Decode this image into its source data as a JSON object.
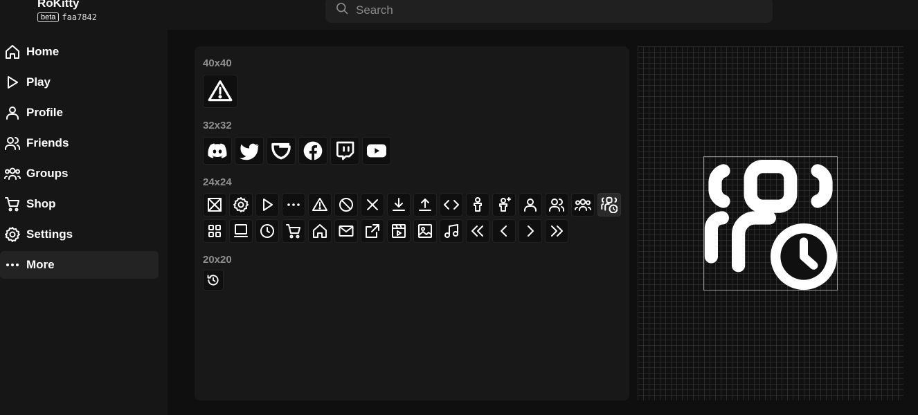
{
  "app": {
    "name": "RoKitty",
    "badge": "beta",
    "commit": "faa7842"
  },
  "search": {
    "placeholder": "Search",
    "value": ""
  },
  "sidebar": {
    "items": [
      {
        "label": "Home",
        "icon": "home-icon"
      },
      {
        "label": "Play",
        "icon": "play-icon"
      },
      {
        "label": "Profile",
        "icon": "profile-icon"
      },
      {
        "label": "Friends",
        "icon": "friends-icon"
      },
      {
        "label": "Groups",
        "icon": "groups-icon"
      },
      {
        "label": "Shop",
        "icon": "cart-icon"
      },
      {
        "label": "Settings",
        "icon": "gear-icon"
      },
      {
        "label": "More",
        "icon": "more-icon",
        "active": true
      }
    ]
  },
  "icon_gallery": {
    "sections": [
      {
        "label": "40x40",
        "icons": [
          "warning-icon"
        ]
      },
      {
        "label": "32x32",
        "icons": [
          "discord-icon",
          "twitter-icon",
          "guilded-icon",
          "facebook-icon",
          "twitch-icon",
          "youtube-icon"
        ]
      },
      {
        "label": "24x24",
        "icons": [
          "missing-image-icon",
          "gear-icon",
          "play-icon",
          "more-icon",
          "warning-icon",
          "blocked-icon",
          "close-icon",
          "download-icon",
          "upload-icon",
          "code-icon",
          "avatar-icon",
          "avatar-sparkle-icon",
          "profile-icon",
          "friends-icon",
          "groups-icon",
          "groups-clock-icon",
          "grid-icon",
          "list-icon",
          "clock-icon",
          "cart-icon",
          "home-icon",
          "mail-icon",
          "external-link-icon",
          "video-icon",
          "image-icon",
          "music-icon",
          "chevron-double-left-icon",
          "chevron-left-icon",
          "chevron-right-icon",
          "chevron-double-right-icon"
        ],
        "selected": "groups-clock-icon"
      },
      {
        "label": "20x20",
        "icons": [
          "history-icon"
        ]
      }
    ]
  },
  "preview": {
    "icon": "groups-clock-icon"
  },
  "colors": {
    "background": "#0f0f0f",
    "panel": "#161616",
    "card": "#181818",
    "label": "#8f8f8f"
  }
}
